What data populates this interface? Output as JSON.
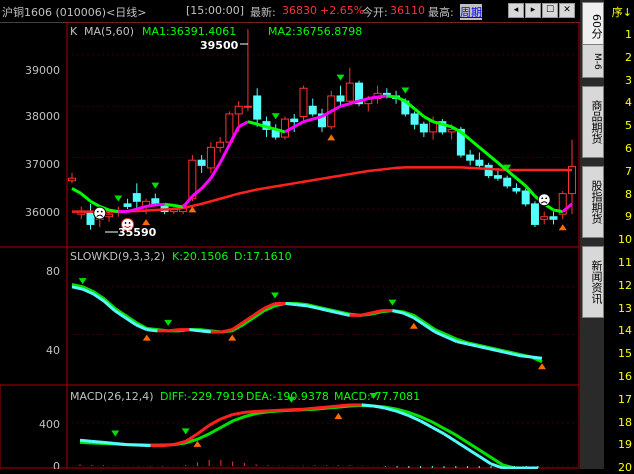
{
  "titlebar": {
    "instrument": "沪铜1606 (010006)<日线>",
    "time": "[15:00:00]",
    "latest_label": "最新:",
    "latest_value": "36830",
    "change": "+2.65%",
    "open_label": "今开:",
    "open_value": "36110",
    "high_label": "最高:",
    "period_link": "周期"
  },
  "window_buttons": [
    "◂",
    "▸",
    "☐",
    "✕"
  ],
  "side_tabs": [
    "60分",
    "商品期货",
    "股指期货",
    "新闻资讯"
  ],
  "side_tab_extra": "M-6",
  "seq_header": "序↓",
  "seq_numbers": [
    "1",
    "2",
    "3",
    "4",
    "5",
    "6",
    "7",
    "8",
    "9",
    "10",
    "11",
    "12",
    "13",
    "14",
    "15",
    "16",
    "17",
    "18",
    "19",
    "20"
  ],
  "price_panel": {
    "header_k": "K",
    "header_ma": "MA(5,60)",
    "ma1": "MA1:36391.4061",
    "ma2": "MA2:36756.8798",
    "high_annot": "39500",
    "low_annot": "35590",
    "yticks": [
      "39000",
      "38000",
      "37000",
      "36000"
    ]
  },
  "kd_panel": {
    "header": "SLOWKD(9,3,3,2)",
    "k": "K:20.1506",
    "d": "D:17.1610",
    "yticks": [
      "80",
      "40"
    ]
  },
  "macd_panel": {
    "header": "MACD(26,12,4)",
    "diff": "DIFF:-229.7919",
    "dea": "DEA:-190.9378",
    "macd": "MACD:-77.7081",
    "yticks": [
      "400",
      "0"
    ]
  },
  "colors": {
    "up": "#ff3232",
    "down": "#54fcfc",
    "ma_short_up": "#ff00ff",
    "ma_short_down": "#00ff00",
    "ma_long": "#ff2020",
    "text": "#c0c0c0",
    "axis": "#b00000"
  },
  "chart_data": {
    "type": "candlestick",
    "title": "沪铜1606 (010006)<日线>",
    "candles_ohlc": [
      [
        36550,
        36700,
        36500,
        36600
      ],
      [
        35900,
        36050,
        35800,
        35950
      ],
      [
        35950,
        36100,
        35600,
        35700
      ],
      [
        35800,
        35900,
        35650,
        35850
      ],
      [
        35850,
        36000,
        35750,
        35900
      ],
      [
        35950,
        36050,
        35850,
        35950
      ],
      [
        36100,
        36200,
        36000,
        36050
      ],
      [
        36300,
        36500,
        35950,
        36150
      ],
      [
        36050,
        36200,
        35900,
        36150
      ],
      [
        36200,
        36300,
        36050,
        36100
      ],
      [
        36050,
        36100,
        35900,
        35950
      ],
      [
        35950,
        36050,
        35900,
        36000
      ],
      [
        35950,
        36100,
        35900,
        36050
      ],
      [
        36200,
        37050,
        36150,
        36950
      ],
      [
        36950,
        37050,
        36700,
        36850
      ],
      [
        36800,
        37300,
        36700,
        37200
      ],
      [
        37200,
        37400,
        37100,
        37300
      ],
      [
        37300,
        37900,
        37250,
        37850
      ],
      [
        37850,
        38100,
        37500,
        38000
      ],
      [
        38000,
        39500,
        37900,
        38000
      ],
      [
        38200,
        38350,
        37600,
        37750
      ],
      [
        37700,
        37800,
        37400,
        37550
      ],
      [
        37550,
        37650,
        37350,
        37400
      ],
      [
        37400,
        37800,
        37350,
        37750
      ],
      [
        37750,
        37850,
        37500,
        37700
      ],
      [
        37800,
        38400,
        37700,
        38350
      ],
      [
        38000,
        38150,
        37800,
        37850
      ],
      [
        37850,
        37950,
        37500,
        37600
      ],
      [
        37600,
        38300,
        37550,
        38200
      ],
      [
        38200,
        38400,
        38000,
        38100
      ],
      [
        38100,
        38750,
        38050,
        38450
      ],
      [
        38450,
        38500,
        38000,
        38050
      ],
      [
        38050,
        38200,
        37900,
        38150
      ],
      [
        38150,
        38400,
        38050,
        38250
      ],
      [
        38250,
        38350,
        38150,
        38200
      ],
      [
        38200,
        38300,
        38050,
        38150
      ],
      [
        38100,
        38150,
        37800,
        37850
      ],
      [
        37850,
        37900,
        37550,
        37650
      ],
      [
        37650,
        37700,
        37400,
        37500
      ],
      [
        37500,
        37800,
        37350,
        37700
      ],
      [
        37700,
        37750,
        37450,
        37500
      ],
      [
        37500,
        37650,
        37350,
        37550
      ],
      [
        37550,
        37600,
        37000,
        37050
      ],
      [
        37050,
        37150,
        36850,
        36950
      ],
      [
        36950,
        37100,
        36800,
        36850
      ],
      [
        36850,
        36900,
        36600,
        36650
      ],
      [
        36650,
        36800,
        36550,
        36600
      ],
      [
        36600,
        36650,
        36400,
        36450
      ],
      [
        36400,
        36500,
        36300,
        36350
      ],
      [
        36350,
        36400,
        36050,
        36100
      ],
      [
        36100,
        36150,
        35650,
        35700
      ],
      [
        35800,
        35950,
        35700,
        35850
      ],
      [
        35850,
        35950,
        35700,
        35800
      ],
      [
        35900,
        36350,
        35800,
        36300
      ],
      [
        36300,
        37350,
        35900,
        36830
      ]
    ],
    "ma_short": [
      36400,
      36300,
      36150,
      36050,
      35980,
      35950,
      35950,
      36000,
      36050,
      36080,
      36090,
      36070,
      36040,
      36250,
      36400,
      36600,
      36900,
      37250,
      37600,
      37700,
      37650,
      37600,
      37550,
      37500,
      37600,
      37700,
      37750,
      37800,
      37900,
      38000,
      38050,
      38100,
      38150,
      38180,
      38200,
      38180,
      38100,
      37950,
      37800,
      37700,
      37650,
      37600,
      37500,
      37350,
      37200,
      37050,
      36900,
      36750,
      36600,
      36450,
      36250,
      36100,
      35980,
      35950,
      36100
    ],
    "ma_long": [
      35950,
      35950,
      35950,
      35950,
      35950,
      35950,
      35960,
      35960,
      35970,
      35980,
      35990,
      36000,
      36020,
      36060,
      36100,
      36150,
      36200,
      36250,
      36300,
      36340,
      36380,
      36410,
      36440,
      36470,
      36500,
      36530,
      36560,
      36590,
      36620,
      36650,
      36680,
      36710,
      36740,
      36760,
      36780,
      36800,
      36810,
      36810,
      36810,
      36810,
      36810,
      36810,
      36810,
      36800,
      36790,
      36780,
      36770,
      36760,
      36760,
      36760,
      36760,
      36760,
      36760,
      36760,
      36757
    ],
    "slowkd_k": [
      80,
      78,
      74,
      68,
      60,
      54,
      48,
      44,
      43,
      43,
      44,
      44,
      43,
      42,
      42,
      44,
      50,
      56,
      62,
      66,
      66,
      65,
      64,
      62,
      60,
      58,
      56,
      56,
      58,
      60,
      60,
      58,
      54,
      48,
      42,
      38,
      34,
      32,
      30,
      28,
      26,
      24,
      22,
      21,
      20
    ],
    "slowkd_d": [
      82,
      80,
      76,
      70,
      62,
      56,
      50,
      45,
      44,
      43,
      43,
      44,
      44,
      43,
      42,
      43,
      48,
      54,
      60,
      64,
      66,
      66,
      65,
      63,
      61,
      59,
      57,
      56,
      57,
      59,
      60,
      59,
      56,
      50,
      44,
      40,
      36,
      33,
      31,
      29,
      27,
      25,
      23,
      21,
      17
    ],
    "macd_diff": [
      240,
      230,
      220,
      210,
      200,
      195,
      190,
      190,
      200,
      230,
      300,
      380,
      440,
      480,
      500,
      510,
      515,
      520,
      525,
      530,
      540,
      550,
      560,
      570,
      570,
      560,
      540,
      510,
      470,
      420,
      360,
      300,
      230,
      160,
      90,
      20,
      -60,
      -140,
      -200,
      -230
    ],
    "macd_dea": [
      220,
      215,
      210,
      205,
      200,
      198,
      195,
      195,
      200,
      215,
      250,
      300,
      360,
      420,
      460,
      490,
      505,
      515,
      520,
      525,
      530,
      540,
      550,
      560,
      565,
      560,
      550,
      530,
      500,
      460,
      410,
      350,
      290,
      220,
      150,
      80,
      10,
      -60,
      -130,
      -191
    ],
    "macd_hist": [
      40,
      30,
      20,
      10,
      0,
      -5,
      -8,
      -10,
      0,
      30,
      100,
      160,
      160,
      120,
      80,
      40,
      20,
      10,
      10,
      10,
      20,
      20,
      20,
      20,
      10,
      0,
      -20,
      -40,
      -60,
      -80,
      -100,
      -100,
      -120,
      -120,
      -120,
      -120,
      -140,
      -160,
      -140,
      -78
    ]
  }
}
